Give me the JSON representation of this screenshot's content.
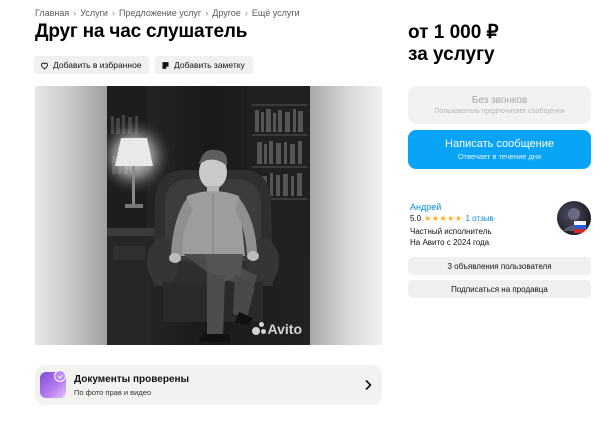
{
  "breadcrumb": [
    "Главная",
    "Услуги",
    "Предложение услуг",
    "Другое",
    "Ещё услуги"
  ],
  "title": "Друг на час слушатель",
  "actions": {
    "favorite_label": "Добавить в избранное",
    "note_label": "Добавить заметку"
  },
  "gallery": {
    "watermark": "Avito"
  },
  "documents": {
    "title": "Документы проверены",
    "subtitle": "По фото прав и видео"
  },
  "price": {
    "line1": "от 1 000 ₽",
    "line2": "за услугу"
  },
  "contact": {
    "calls_label": "Без звонков",
    "calls_sub": "Пользователь предпочитает сообщения",
    "message_label": "Написать сообщение",
    "message_sub": "Отвечает в течение дня"
  },
  "seller": {
    "name": "Андрей",
    "rating": "5.0",
    "stars": "★★★★★",
    "reviews": "1 отзыв",
    "type": "Частный исполнитель",
    "since": "На Авито с 2024 года",
    "ads_button": "3 объявления пользователя",
    "subscribe_button": "Подписаться на продавца"
  },
  "colors": {
    "accent": "#0aa4f6",
    "link": "#0a8de0",
    "star": "#ffb21e"
  },
  "icons": [
    "heart-icon",
    "note-icon",
    "chevron-right-icon",
    "verified-check-icon"
  ]
}
